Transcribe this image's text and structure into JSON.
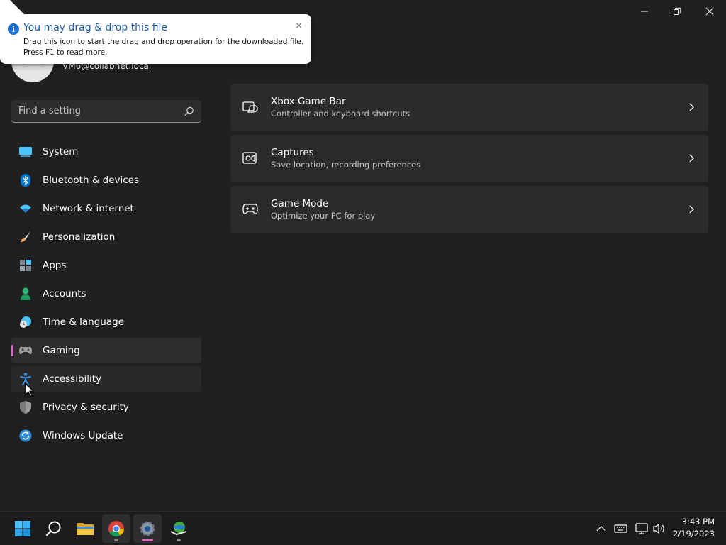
{
  "window": {
    "controls": [
      "minimize",
      "restore",
      "close"
    ]
  },
  "account": {
    "email": "VM6@collabnet.local"
  },
  "search": {
    "placeholder": "Find a setting"
  },
  "nav": {
    "items": [
      {
        "label": "System",
        "icon": "system-icon",
        "color": "#4cc2ff"
      },
      {
        "label": "Bluetooth & devices",
        "icon": "bluetooth-icon",
        "color": "#0078d4"
      },
      {
        "label": "Network & internet",
        "icon": "wifi-icon",
        "color": "#4cc2ff"
      },
      {
        "label": "Personalization",
        "icon": "brush-icon",
        "color": "#f0a34a"
      },
      {
        "label": "Apps",
        "icon": "apps-icon",
        "color": "#9aa4b1"
      },
      {
        "label": "Accounts",
        "icon": "person-icon",
        "color": "#2bb673"
      },
      {
        "label": "Time & language",
        "icon": "globe-clock-icon",
        "color": "#4cc2ff"
      },
      {
        "label": "Gaming",
        "icon": "gamepad-icon",
        "color": "#a0a0a0"
      },
      {
        "label": "Accessibility",
        "icon": "accessibility-icon",
        "color": "#3a8fe0"
      },
      {
        "label": "Privacy & security",
        "icon": "shield-icon",
        "color": "#9a9a9a"
      },
      {
        "label": "Windows Update",
        "icon": "update-icon",
        "color": "#2d8bd8"
      }
    ],
    "selected": "Gaming",
    "accent": "#d86ec4"
  },
  "cards": [
    {
      "title": "Xbox Game Bar",
      "subtitle": "Controller and keyboard shortcuts",
      "icon": "game-bar-icon"
    },
    {
      "title": "Captures",
      "subtitle": "Save location, recording preferences",
      "icon": "capture-icon"
    },
    {
      "title": "Game Mode",
      "subtitle": "Optimize your PC for play",
      "icon": "gamepad-icon"
    }
  ],
  "popup": {
    "title": "You may drag & drop this file",
    "line1": "Drag this icon to start the drag and drop operation for the downloaded file.",
    "line2": "Press F1 to read more.",
    "close": "×"
  },
  "taskbar": {
    "apps": [
      "start-icon",
      "search-icon",
      "file-explorer-icon",
      "chrome-icon",
      "settings-icon",
      "download-manager-icon"
    ],
    "time": "3:43 PM",
    "date": "2/19/2023"
  }
}
